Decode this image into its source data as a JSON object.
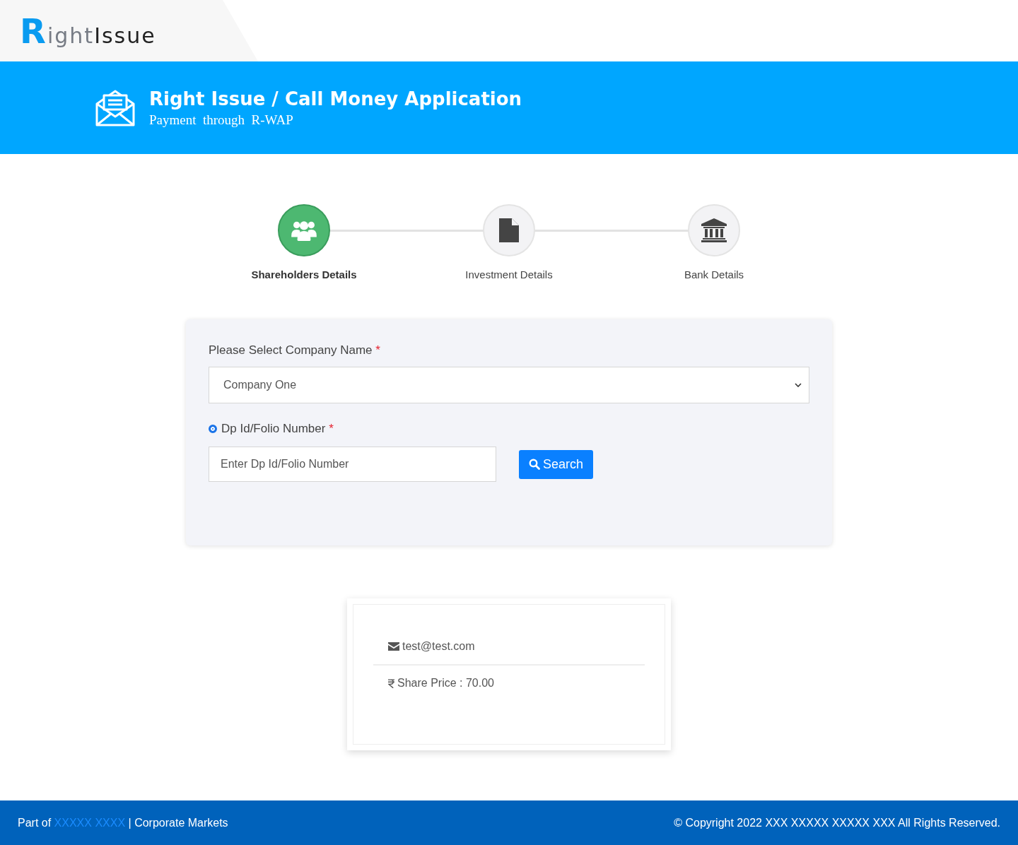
{
  "logo": {
    "initial": "R",
    "middle": "ight",
    "end": "Issue"
  },
  "banner": {
    "title": "Right Issue / Call Money Application",
    "subtitle": "Payment  through  R-WAP"
  },
  "steps": [
    {
      "label": "Shareholders Details",
      "kind": "people",
      "selected": true
    },
    {
      "label": "Investment Details",
      "kind": "document",
      "selected": false
    },
    {
      "label": "Bank Details",
      "kind": "bank",
      "selected": false
    }
  ],
  "form": {
    "company_label": "Please Select Company Name",
    "company_required": "*",
    "company_value": "Company One",
    "id_label": "Dp Id/Folio Number",
    "id_required": "*",
    "id_selected": true,
    "id_placeholder": "Enter Dp Id/Folio Number",
    "search_button": "Search"
  },
  "info": {
    "email": "test@test.com",
    "share_price": "Share Price : 70.00"
  },
  "footer": {
    "prefix": "Part of",
    "link": "XXXXX XXXX",
    "suffix": "| Corporate Markets",
    "copyright": "© Copyright 2022 XXX XXXXX XXXXX XXX All Rights Reserved."
  }
}
